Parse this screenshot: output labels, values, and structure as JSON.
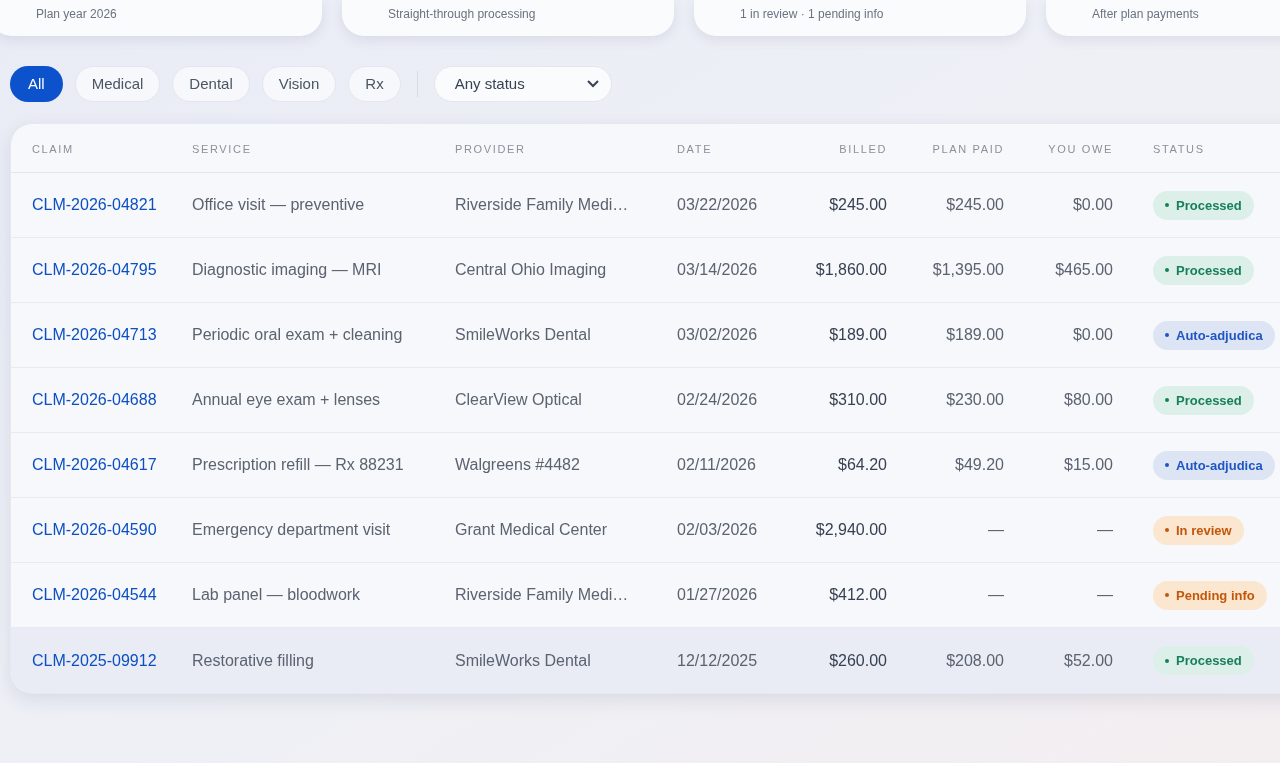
{
  "summary_cards": [
    {
      "caption": "Plan year 2026"
    },
    {
      "caption": "Straight-through processing"
    },
    {
      "caption": "1 in review · 1 pending info"
    },
    {
      "caption": "After plan payments"
    }
  ],
  "filters": [
    {
      "label": "All",
      "selected": true
    },
    {
      "label": "Medical",
      "selected": false
    },
    {
      "label": "Dental",
      "selected": false
    },
    {
      "label": "Vision",
      "selected": false
    },
    {
      "label": "Rx",
      "selected": false
    }
  ],
  "status_filter": {
    "value": "Any status"
  },
  "table": {
    "columns": [
      "CLAIM",
      "SERVICE",
      "PROVIDER",
      "DATE",
      "BILLED",
      "PLAN PAID",
      "YOU OWE",
      "STATUS"
    ],
    "rows": [
      {
        "claim": "CLM-2026-04821",
        "service": "Office visit — preventive",
        "provider": "Riverside Family Medi…",
        "date": "03/22/2026",
        "billed": "$245.00",
        "plan_paid": "$245.00",
        "you_owe": "$0.00",
        "status": {
          "label": "Processed",
          "kind": "processed"
        },
        "selected": false
      },
      {
        "claim": "CLM-2026-04795",
        "service": "Diagnostic imaging — MRI",
        "provider": "Central Ohio Imaging",
        "date": "03/14/2026",
        "billed": "$1,860.00",
        "plan_paid": "$1,395.00",
        "you_owe": "$465.00",
        "status": {
          "label": "Processed",
          "kind": "processed"
        },
        "selected": false
      },
      {
        "claim": "CLM-2026-04713",
        "service": "Periodic oral exam + cleaning",
        "provider": "SmileWorks Dental",
        "date": "03/02/2026",
        "billed": "$189.00",
        "plan_paid": "$189.00",
        "you_owe": "$0.00",
        "status": {
          "label": "Auto-adjudica",
          "kind": "auto"
        },
        "selected": false
      },
      {
        "claim": "CLM-2026-04688",
        "service": "Annual eye exam + lenses",
        "provider": "ClearView Optical",
        "date": "02/24/2026",
        "billed": "$310.00",
        "plan_paid": "$230.00",
        "you_owe": "$80.00",
        "status": {
          "label": "Processed",
          "kind": "processed"
        },
        "selected": false
      },
      {
        "claim": "CLM-2026-04617",
        "service": "Prescription refill — Rx 88231",
        "provider": "Walgreens #4482",
        "date": "02/11/2026",
        "billed": "$64.20",
        "plan_paid": "$49.20",
        "you_owe": "$15.00",
        "status": {
          "label": "Auto-adjudica",
          "kind": "auto"
        },
        "selected": false
      },
      {
        "claim": "CLM-2026-04590",
        "service": "Emergency department visit",
        "provider": "Grant Medical Center",
        "date": "02/03/2026",
        "billed": "$2,940.00",
        "plan_paid": "—",
        "you_owe": "—",
        "status": {
          "label": "In review",
          "kind": "review"
        },
        "selected": false
      },
      {
        "claim": "CLM-2026-04544",
        "service": "Lab panel — bloodwork",
        "provider": "Riverside Family Medi…",
        "date": "01/27/2026",
        "billed": "$412.00",
        "plan_paid": "—",
        "you_owe": "—",
        "status": {
          "label": "Pending info",
          "kind": "pending"
        },
        "selected": false
      },
      {
        "claim": "CLM-2025-09912",
        "service": "Restorative filling",
        "provider": "SmileWorks Dental",
        "date": "12/12/2025",
        "billed": "$260.00",
        "plan_paid": "$208.00",
        "you_owe": "$52.00",
        "status": {
          "label": "Processed",
          "kind": "processed"
        },
        "selected": true
      }
    ]
  }
}
